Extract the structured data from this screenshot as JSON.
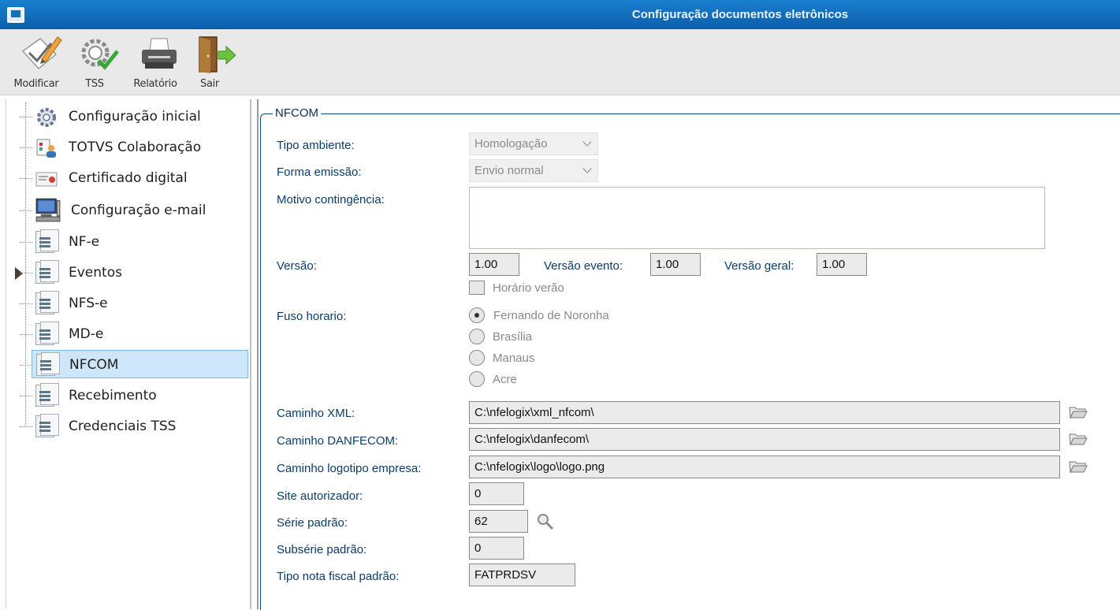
{
  "window": {
    "title": "Configuração documentos eletrônicos"
  },
  "toolbar": {
    "modify_label": "Modificar",
    "tss_label": "TSS",
    "report_label": "Relatório",
    "exit_label": "Sair"
  },
  "tree": {
    "items": [
      {
        "label": "Configuração inicial",
        "icon": "gear-icon"
      },
      {
        "label": "TOTVS Colaboração",
        "icon": "collaboration-icon"
      },
      {
        "label": "Certificado digital",
        "icon": "certificate-icon"
      },
      {
        "label": "Configuração e-mail",
        "icon": "computer-icon"
      },
      {
        "label": "NF-e",
        "icon": "document-list-icon"
      },
      {
        "label": "Eventos",
        "icon": "document-list-icon"
      },
      {
        "label": "NFS-e",
        "icon": "document-list-icon"
      },
      {
        "label": "MD-e",
        "icon": "document-list-icon"
      },
      {
        "label": "NFCOM",
        "icon": "document-list-icon",
        "selected": true
      },
      {
        "label": "Recebimento",
        "icon": "document-list-icon"
      },
      {
        "label": "Credenciais TSS",
        "icon": "document-list-icon"
      }
    ]
  },
  "form": {
    "group_title": "NFCOM",
    "tipo_ambiente": {
      "label": "Tipo ambiente:",
      "value": "Homologação"
    },
    "forma_emissao": {
      "label": "Forma emissão:",
      "value": "Envio normal"
    },
    "motivo_contingencia": {
      "label": "Motivo contingência:",
      "value": ""
    },
    "versao": {
      "label": "Versão:",
      "value": "1.00"
    },
    "versao_evento": {
      "label": "Versão evento:",
      "value": "1.00"
    },
    "versao_geral": {
      "label": "Versão geral:",
      "value": "1.00"
    },
    "horario_verao": {
      "label": "Horário verão",
      "checked": false
    },
    "fuso_horario": {
      "label": "Fuso horario:",
      "options": [
        "Fernando de Noronha",
        "Brasília",
        "Manaus",
        "Acre"
      ],
      "selected": "Fernando de Noronha"
    },
    "caminho_xml": {
      "label": "Caminho XML:",
      "value": "C:\\nfelogix\\xml_nfcom\\"
    },
    "caminho_danfecom": {
      "label": "Caminho DANFECOM:",
      "value": "C:\\nfelogix\\danfecom\\"
    },
    "caminho_logotipo": {
      "label": "Caminho logotipo empresa:",
      "value": "C:\\nfelogix\\logo\\logo.png"
    },
    "site_autorizador": {
      "label": "Site autorizador:",
      "value": "0"
    },
    "serie_padrao": {
      "label": "Série padrão:",
      "value": "62"
    },
    "subserie_padrao": {
      "label": "Subsérie padrão:",
      "value": "0"
    },
    "tipo_nota_fiscal": {
      "label": "Tipo nota fiscal padrão:",
      "value": "FATPRDSV"
    }
  },
  "colors": {
    "title_bar": "#0b6fc1",
    "label_text": "#0a3d6b",
    "selection": "#cde6f9"
  }
}
